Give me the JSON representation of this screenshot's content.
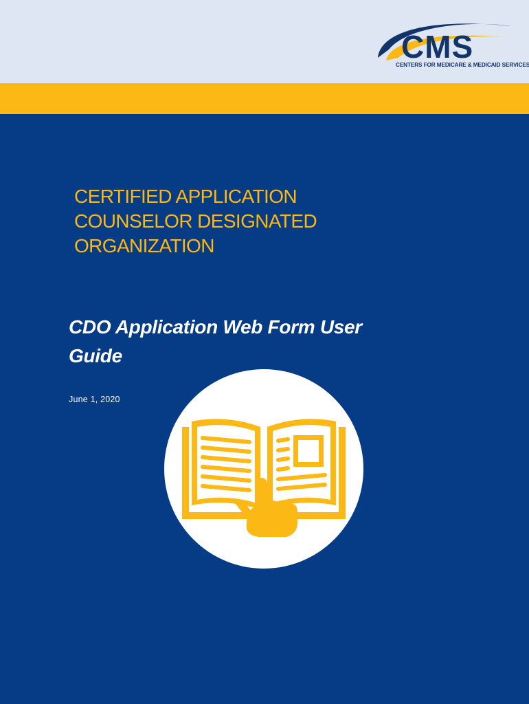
{
  "header": {
    "logo": {
      "mark_text": "CMS",
      "tagline": "CENTERS FOR MEDICARE & MEDICAID SERVICES",
      "icon": "cms-logo-icon"
    }
  },
  "colors": {
    "header_bg": "#dde6f2",
    "accent_yellow": "#fcb814",
    "brand_blue": "#063c86",
    "logo_blue": "#12346b",
    "white": "#ffffff"
  },
  "cover": {
    "organization_title_lines": [
      "CERTIFIED APPLICATION",
      "COUNSELOR DESIGNATED",
      "ORGANIZATION"
    ],
    "document_title_lines": [
      "CDO Application Web Form User",
      "Guide"
    ],
    "date": "June 1, 2020",
    "illustration_icon": "open-book-icon"
  }
}
